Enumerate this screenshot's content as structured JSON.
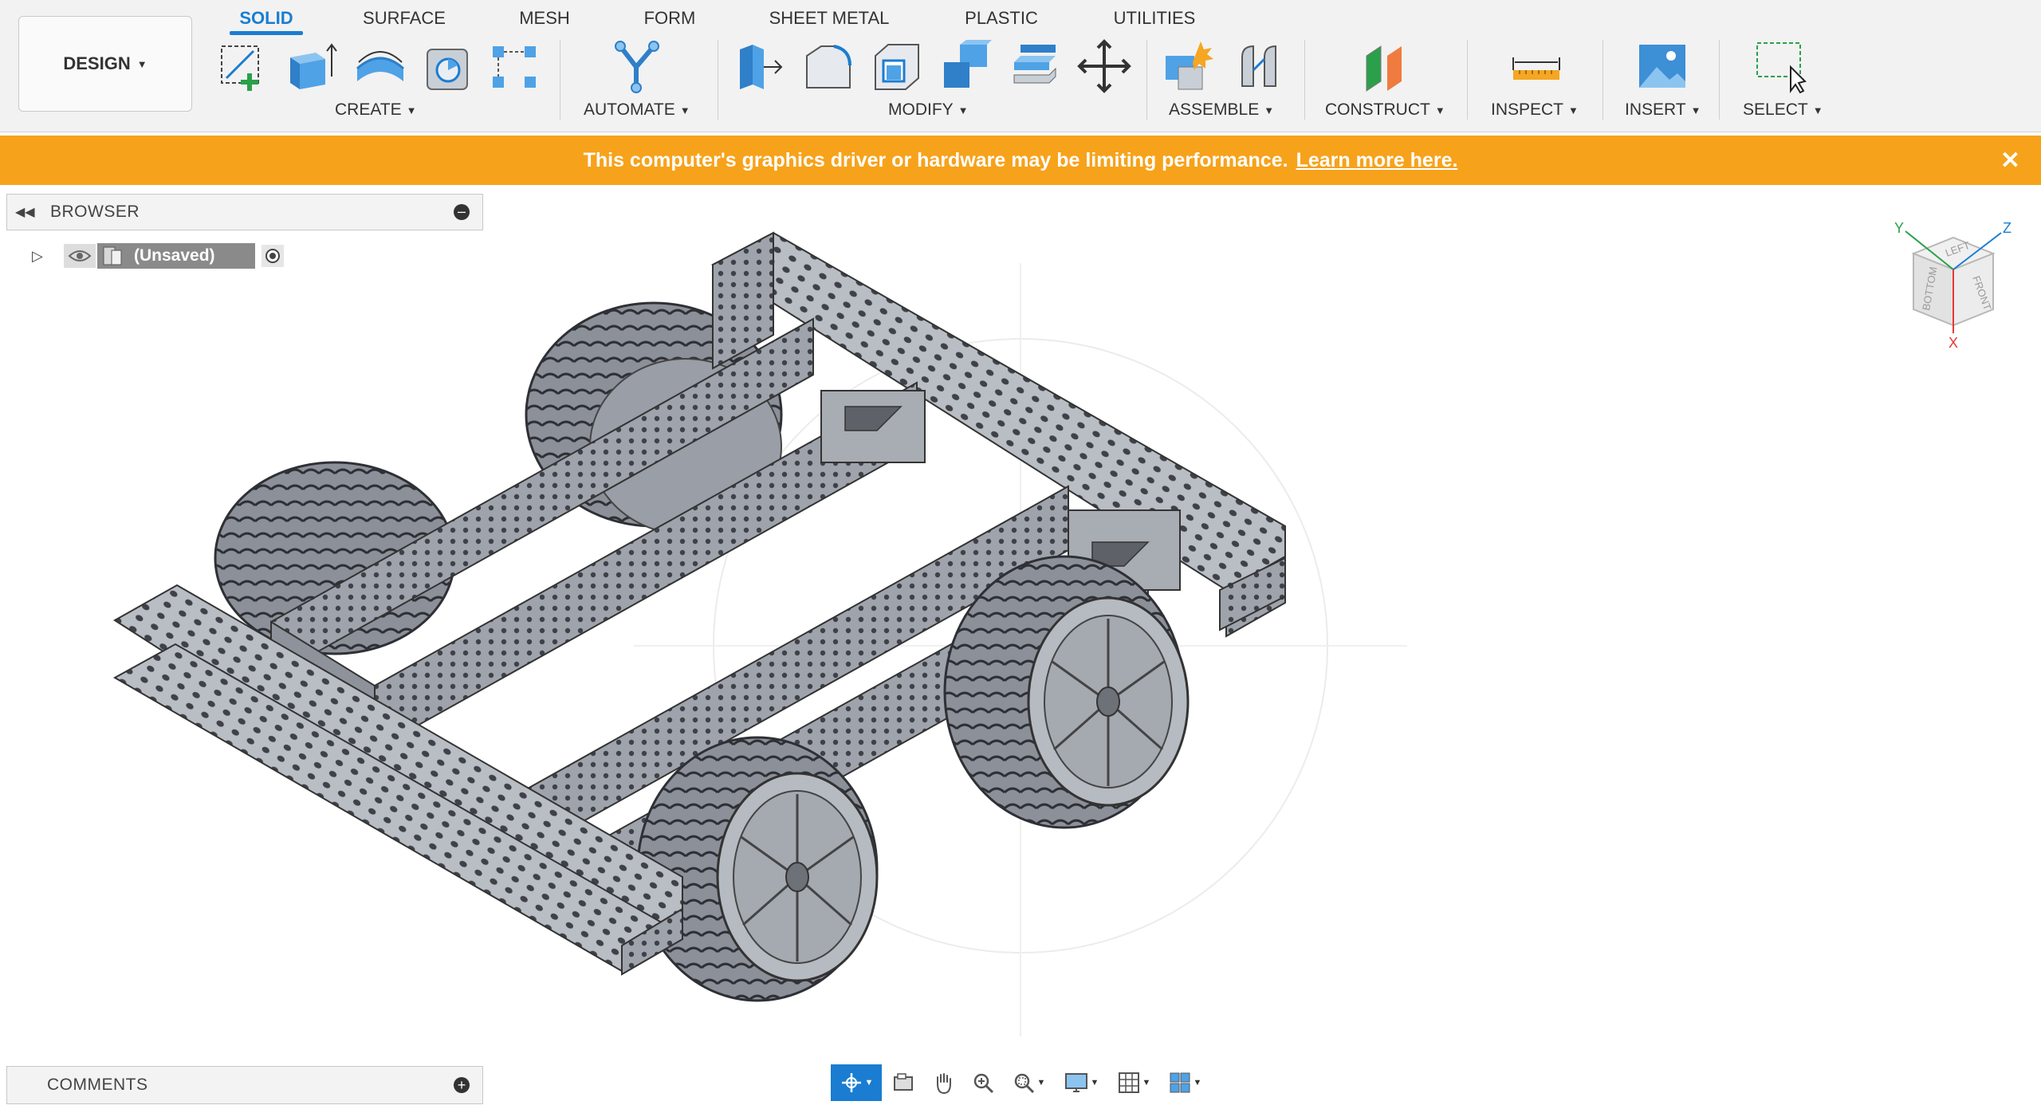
{
  "workspace": {
    "label": "DESIGN"
  },
  "tabs": [
    {
      "label": "SOLID",
      "active": true
    },
    {
      "label": "SURFACE"
    },
    {
      "label": "MESH"
    },
    {
      "label": "FORM"
    },
    {
      "label": "SHEET METAL"
    },
    {
      "label": "PLASTIC"
    },
    {
      "label": "UTILITIES"
    }
  ],
  "groups": {
    "create": "CREATE",
    "automate": "AUTOMATE",
    "modify": "MODIFY",
    "assemble": "ASSEMBLE",
    "construct": "CONSTRUCT",
    "inspect": "INSPECT",
    "insert": "INSERT",
    "select": "SELECT"
  },
  "tool_icons": {
    "create": [
      "create-sketch-icon",
      "extrude-icon",
      "revolve-icon",
      "shell-icon",
      "pattern-icon"
    ],
    "automate": [
      "automate-icon"
    ],
    "modify": [
      "press-pull-icon",
      "fillet-icon",
      "shell-modify-icon",
      "combine-icon",
      "offset-face-icon",
      "move-icon"
    ],
    "assemble": [
      "new-component-icon",
      "joint-icon"
    ],
    "construct": [
      "offset-plane-icon"
    ],
    "inspect": [
      "measure-icon"
    ],
    "insert": [
      "insert-image-icon"
    ],
    "select": [
      "select-window-icon"
    ]
  },
  "banner": {
    "message": "This computer's graphics driver or hardware may be limiting performance.",
    "link": "Learn more here.",
    "color": "#f7a21b"
  },
  "browser": {
    "title": "BROWSER",
    "root_node": "(Unsaved)"
  },
  "viewcube": {
    "faces": [
      "LEFT",
      "FRONT",
      "BOTTOM"
    ],
    "axes": [
      "Y",
      "Z",
      "X"
    ]
  },
  "comments": {
    "title": "COMMENTS"
  },
  "navbar_icons": [
    "orbit-icon",
    "look-at-icon",
    "pan-icon",
    "zoom-icon",
    "fit-icon",
    "display-settings-icon",
    "grid-settings-icon",
    "viewports-icon"
  ],
  "accent_color": "#1a7dd1"
}
